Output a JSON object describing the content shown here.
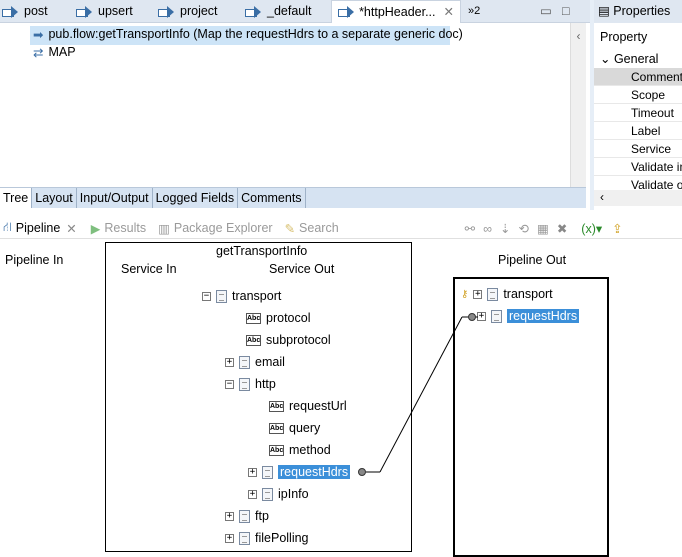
{
  "editor_tabs": [
    {
      "label": "post"
    },
    {
      "label": "upsert"
    },
    {
      "label": "project"
    },
    {
      "label": "_default"
    },
    {
      "label": "*httpHeader..."
    }
  ],
  "overflow_tabs": "»2",
  "flow_steps": [
    {
      "label": "pub.flow:getTransportInfo (Map the requestHdrs to a separate generic doc)"
    },
    {
      "label": "MAP"
    }
  ],
  "bottom_tabs": [
    "Tree",
    "Layout",
    "Input/Output",
    "Logged Fields",
    "Comments"
  ],
  "properties": {
    "title": "Properties",
    "header": "Property",
    "group": "General",
    "rows": [
      "Comments",
      "Scope",
      "Timeout",
      "Label",
      "Service",
      "Validate in",
      "Validate o"
    ]
  },
  "views": {
    "pipeline": "Pipeline",
    "results": "Results",
    "package_explorer": "Package Explorer",
    "search": "Search"
  },
  "pipeline": {
    "pipeline_in": "Pipeline In",
    "service_name": "getTransportInfo",
    "service_in": "Service In",
    "service_out": "Service Out",
    "pipeline_out": "Pipeline Out",
    "service_out_tree": [
      "transport",
      "protocol",
      "subprotocol",
      "email",
      "http",
      "requestUrl",
      "query",
      "method",
      "requestHdrs",
      "ipInfo",
      "ftp",
      "filePolling"
    ],
    "pipeline_out_tree": [
      "transport",
      "requestHdrs"
    ]
  }
}
